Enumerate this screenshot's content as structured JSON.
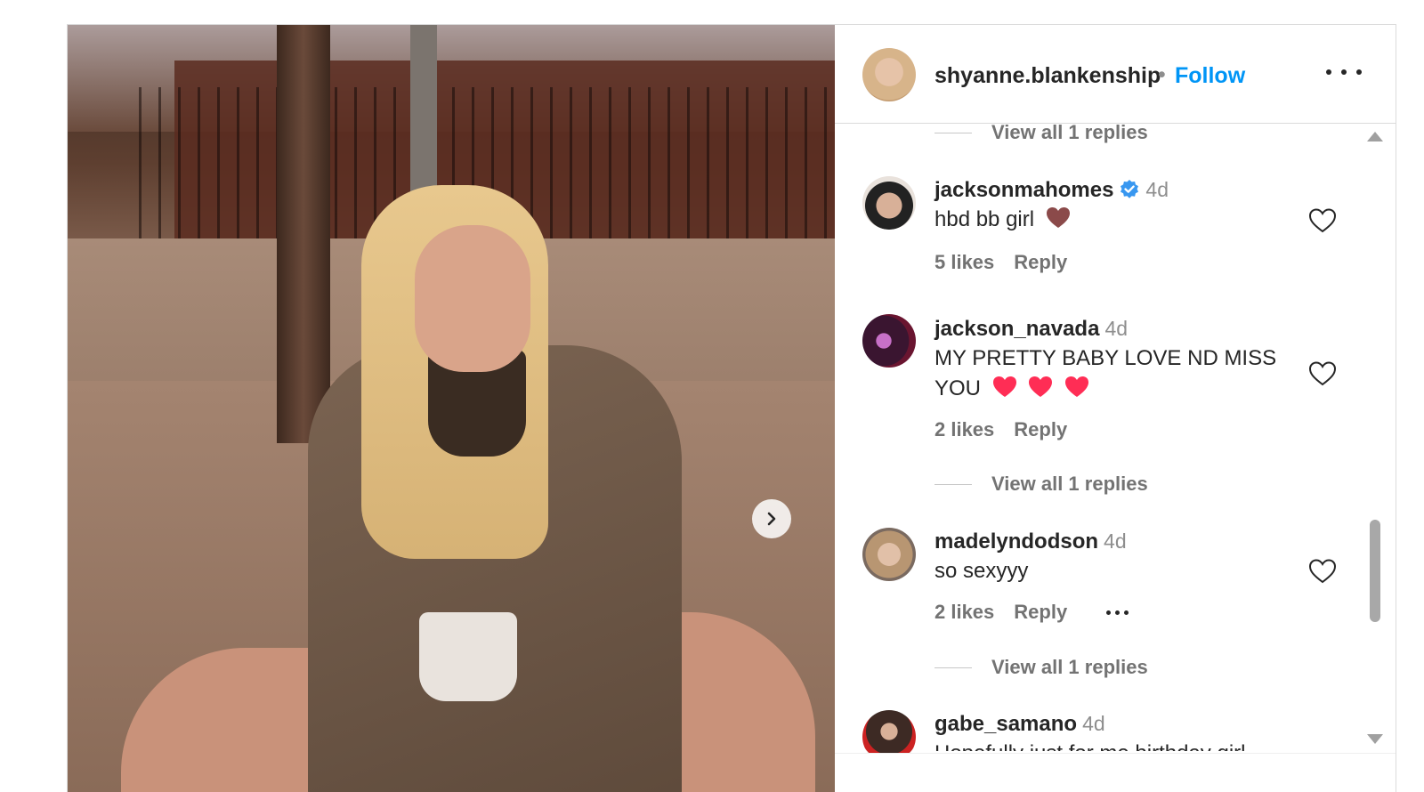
{
  "post": {
    "owner": {
      "username": "shyanne.blankenship",
      "separator": "•",
      "follow_label": "Follow"
    },
    "photo": {
      "description_icon": "photo"
    },
    "colors": {
      "accent": "#0095f6",
      "verified": "#3897f0",
      "heart_emoji_brown": "#8b4a4a",
      "heart_emoji_pink": "#ff2d55"
    }
  },
  "comments": {
    "view_replies_label_top": "View all 1 replies",
    "items": [
      {
        "username": "jacksonmahomes",
        "verified": true,
        "time": "4d",
        "text": "hbd bb girl",
        "emoji": "brown-heart",
        "likes": "5 likes",
        "reply": "Reply"
      },
      {
        "username": "jackson_navada",
        "verified": false,
        "time": "4d",
        "text_line1": "MY PRETTY BABY LOVE ND MISS",
        "text_line2": "YOU",
        "emoji": "red-hearts",
        "likes": "2 likes",
        "reply": "Reply",
        "view_replies": "View all 1 replies"
      },
      {
        "username": "madelyndodson",
        "verified": false,
        "time": "4d",
        "text": "so sexyyy",
        "likes": "2 likes",
        "reply": "Reply",
        "view_replies": "View all 1 replies"
      },
      {
        "username": "gabe_samano",
        "verified": false,
        "time": "4d",
        "text": "Hopefully just for me birthday girl"
      }
    ]
  }
}
